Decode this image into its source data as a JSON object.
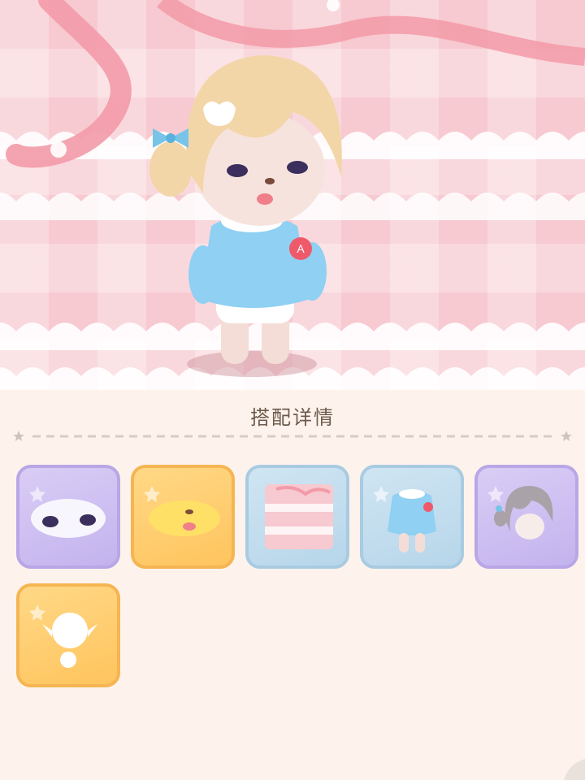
{
  "panel": {
    "title": "搭配详情"
  },
  "items": [
    {
      "name": "eyes",
      "tier": "purple",
      "icon": "eyes-item-icon"
    },
    {
      "name": "mouth",
      "tier": "orange",
      "icon": "mouth-item-icon"
    },
    {
      "name": "background",
      "tier": "blue",
      "icon": "background-item-icon"
    },
    {
      "name": "outfit",
      "tier": "blue",
      "icon": "outfit-item-icon"
    },
    {
      "name": "hair",
      "tier": "purple",
      "icon": "hair-item-icon"
    },
    {
      "name": "body",
      "tier": "orange",
      "icon": "body-item-icon"
    }
  ],
  "colors": {
    "panel_bg": "#fdf3ec",
    "title_text": "#6d5a4c",
    "tier_purple": "#c3b3ee",
    "tier_orange": "#ffc45e",
    "tier_blue": "#b7d6ea"
  }
}
